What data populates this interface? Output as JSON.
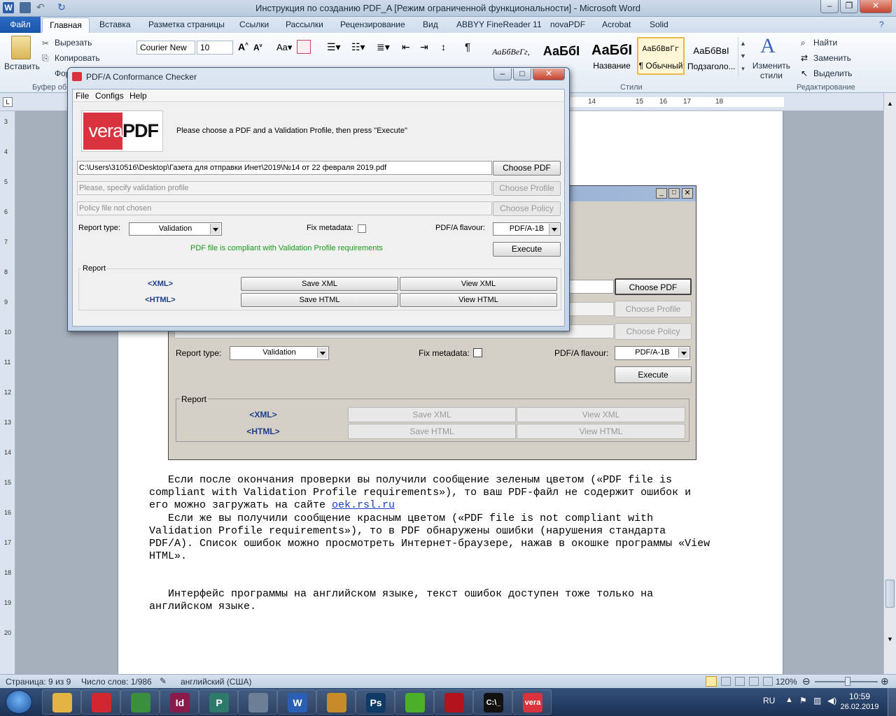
{
  "word": {
    "title": "Инструкция по созданию PDF_A [Режим ограниченной функциональности]  -  Microsoft Word",
    "tabs": [
      "Файл",
      "Главная",
      "Вставка",
      "Разметка страницы",
      "Ссылки",
      "Рассылки",
      "Рецензирование",
      "Вид",
      "ABBYY FineReader 11",
      "novaPDF",
      "Acrobat",
      "Solid"
    ],
    "clipboard": {
      "paste": "Вставить",
      "cut": "Вырезать",
      "copy": "Копировать",
      "format": "Фор",
      "group": "Буфер об"
    },
    "font": {
      "name": "Courier New",
      "size": "10"
    },
    "styles": [
      {
        "preview": "АаБбВеГг,",
        "label": ""
      },
      {
        "preview": "АаБбI",
        "label": ""
      },
      {
        "preview": "АаБбI",
        "label": "Название"
      },
      {
        "preview": "АаБбВвГг",
        "label": "¶ Обычный"
      },
      {
        "preview": "АаБбВвI",
        "label": "Подзаголо..."
      }
    ],
    "styles_group": "Стили",
    "change_styles": "Изменить стили",
    "editing": {
      "find": "Найти",
      "replace": "Заменить",
      "select": "Выделить",
      "group": "Редактирование"
    },
    "ruler_numbers": [
      "14",
      "15",
      "16",
      "17",
      "18"
    ],
    "vruler_numbers": [
      "3",
      "4",
      "5",
      "6",
      "7",
      "8",
      "9",
      "10",
      "11",
      "12",
      "13",
      "14",
      "15",
      "16",
      "17",
      "18",
      "19",
      "20"
    ],
    "paragraphs": [
      "   Если после окончания проверки вы получили сообщение зеленым цветом («PDF file is",
      "compliant with Validation Profile requirements»), то ваш PDF-файл не содержит ошибок и",
      "его можно загружать на сайте ",
      "   Если же вы получили сообщение красным цветом («PDF file is not compliant with",
      "Validation Profile requirements»), то в PDF обнаружены ошибки (нарушения стандарта",
      "PDF/A). Список ошибок можно просмотреть Интернет-браузере, нажав в окошке программы «View",
      "HTML».",
      "   Интерфейс программы на английском языке, текст ошибок доступен тоже только на",
      "английском языке."
    ],
    "link": "oek.rsl.ru",
    "status": {
      "page": "Страница: 9 из 9",
      "words": "Число слов: 1/986",
      "lang": "английский (США)",
      "zoom": "120%"
    }
  },
  "embedded": {
    "choose_pdf": "Choose PDF",
    "choose_profile": "Choose Profile",
    "choose_policy": "Choose Policy",
    "report_type_label": "Report type:",
    "report_type": "Validation",
    "fix_metadata": "Fix metadata:",
    "flavour_label": "PDF/A flavour:",
    "flavour": "PDF/A-1B",
    "execute": "Execute",
    "report": "Report",
    "xml": "<XML>",
    "html": "<HTML>",
    "save_xml": "Save XML",
    "view_xml": "View XML",
    "save_html": "Save HTML",
    "view_html": "View HTML"
  },
  "vera": {
    "title": "PDF/A Conformance Checker",
    "menu": [
      "File",
      "Configs",
      "Help"
    ],
    "logo_left": "vera",
    "logo_right": "PDF",
    "instructions": "Please choose a PDF and a Validation Profile, then press \"Execute\"",
    "pdf_path": "C:\\Users\\310516\\Desktop\\Газета для отправки Инет\\2019\\№14 от 22 февраля 2019.pdf",
    "profile_placeholder": "Please, specify validation profile",
    "policy_placeholder": "Policy file not chosen",
    "choose_pdf": "Choose PDF",
    "choose_profile": "Choose Profile",
    "choose_policy": "Choose Policy",
    "report_type_label": "Report type:",
    "report_type": "Validation",
    "fix_metadata": "Fix metadata:",
    "flavour_label": "PDF/A flavour:",
    "flavour": "PDF/A-1B",
    "status": "PDF file is compliant with Validation Profile requirements",
    "execute": "Execute",
    "report": "Report",
    "xml": "<XML>",
    "html": "<HTML>",
    "save_xml": "Save XML",
    "view_xml": "View XML",
    "save_html": "Save HTML",
    "view_html": "View HTML",
    "status_color": "#1a9a1a"
  },
  "taskbar": {
    "apps": [
      {
        "label": "",
        "icon": "file-explorer-icon"
      },
      {
        "label": "",
        "icon": "record-app-icon"
      },
      {
        "label": "",
        "icon": "chrome-icon"
      },
      {
        "label": "Id",
        "icon": "indesign-icon"
      },
      {
        "label": "P",
        "icon": "publisher-icon"
      },
      {
        "label": "",
        "icon": "calculator-icon"
      },
      {
        "label": "W",
        "icon": "word-icon"
      },
      {
        "label": "",
        "icon": "paint-icon"
      },
      {
        "label": "Ps",
        "icon": "photoshop-icon"
      },
      {
        "label": "",
        "icon": "utorrent-icon"
      },
      {
        "label": "",
        "icon": "acrobat-icon"
      },
      {
        "label": "C:\\_",
        "icon": "cmd-icon"
      },
      {
        "label": "vera",
        "icon": "verapdf-icon"
      }
    ],
    "lang": "RU",
    "time": "10:59",
    "date": "26.02.2019"
  }
}
